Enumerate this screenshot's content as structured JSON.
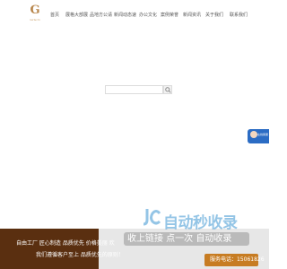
{
  "header": {
    "logo_letter": "G",
    "logo_sub": "Girlscm",
    "nav": [
      "首页",
      "展格大部展",
      "品地方公请",
      "新闻动态速",
      "办公文化",
      "案例荣誉",
      "新闻资讯",
      "关于我们",
      "联系我们"
    ]
  },
  "search": {
    "placeholder": "",
    "icon": "search-icon"
  },
  "float_contact": {
    "label": "在线客服",
    "icon": "customer-service-avatar-icon"
  },
  "banner": {
    "slogan_line1": "自由工厂 匠心制造 品质优先 价格美丽 欢",
    "slogan_line2": "我们遵循客户至上 品质优先的原则！",
    "phone_label": "服务电话：15061826"
  },
  "watermark": {
    "main": "自动秒收录",
    "sub": "收上链接 点一次 自动收录",
    "icon": "jc-logo-icon"
  },
  "colors": {
    "brand": "#b8864b",
    "banner_dark": "#5a2f10",
    "accent_orange": "#c77c22",
    "contact_blue": "#2b6cc4"
  }
}
